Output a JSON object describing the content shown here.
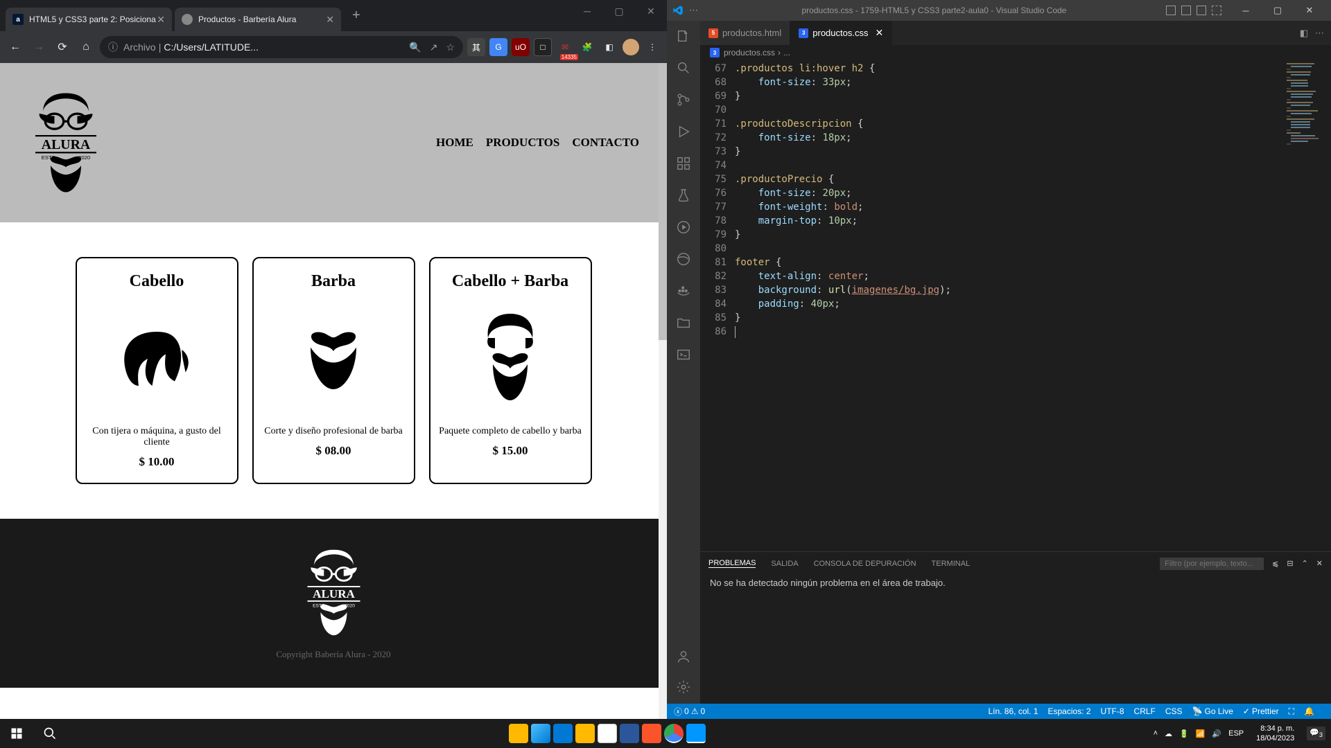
{
  "chrome": {
    "tabs": [
      {
        "title": "HTML5 y CSS3 parte 2: Posiciona",
        "favtype": "alura",
        "favlabel": "a"
      },
      {
        "title": "Productos - Barbería Alura",
        "favtype": "globe",
        "favlabel": ""
      }
    ],
    "omnibox_prefix": "Archivo",
    "omnibox_url": "C:/Users/LATITUDE...",
    "ext_badge": "14335"
  },
  "page": {
    "nav": {
      "home": "HOME",
      "productos": "PRODUCTOS",
      "contacto": "CONTACTO"
    },
    "productos": [
      {
        "title": "Cabello",
        "desc": "Con tijera o máquina, a gusto del cliente",
        "precio": "$ 10.00"
      },
      {
        "title": "Barba",
        "desc": "Corte y diseño profesional de barba",
        "precio": "$ 08.00"
      },
      {
        "title": "Cabello + Barba",
        "desc": "Paquete completo de cabello y barba",
        "precio": "$ 15.00"
      }
    ],
    "footer_copy": "Copyright Babería Alura - 2020"
  },
  "vscode": {
    "title": "productos.css - 1759-HTML5 y CSS3 parte2-aula0 - Visual Studio Code",
    "tabs": [
      {
        "name": "productos.html",
        "type": "html"
      },
      {
        "name": "productos.css",
        "type": "css",
        "active": true
      }
    ],
    "breadcrumb": "productos.css",
    "code_lines": [
      {
        "n": 67,
        "html": "<span class='selector'>.productos li:hover h2</span> <span class='punct'>{</span>"
      },
      {
        "n": 68,
        "html": "    <span class='prop'>font-size</span><span class='punct'>:</span> <span class='num'>33px</span><span class='punct'>;</span>"
      },
      {
        "n": 69,
        "html": "<span class='punct'>}</span>"
      },
      {
        "n": 70,
        "html": ""
      },
      {
        "n": 71,
        "html": "<span class='selector'>.productoDescripcion</span> <span class='punct'>{</span>"
      },
      {
        "n": 72,
        "html": "    <span class='prop'>font-size</span><span class='punct'>:</span> <span class='num'>18px</span><span class='punct'>;</span>"
      },
      {
        "n": 73,
        "html": "<span class='punct'>}</span>"
      },
      {
        "n": 74,
        "html": ""
      },
      {
        "n": 75,
        "html": "<span class='selector'>.productoPrecio</span> <span class='punct'>{</span>"
      },
      {
        "n": 76,
        "html": "    <span class='prop'>font-size</span><span class='punct'>:</span> <span class='num'>20px</span><span class='punct'>;</span>"
      },
      {
        "n": 77,
        "html": "    <span class='prop'>font-weight</span><span class='punct'>:</span> <span class='val'>bold</span><span class='punct'>;</span>"
      },
      {
        "n": 78,
        "html": "    <span class='prop'>margin-top</span><span class='punct'>:</span> <span class='num'>10px</span><span class='punct'>;</span>"
      },
      {
        "n": 79,
        "html": "<span class='punct'>}</span>"
      },
      {
        "n": 80,
        "html": ""
      },
      {
        "n": 81,
        "html": "<span class='selector'>footer</span> <span class='punct'>{</span>"
      },
      {
        "n": 82,
        "html": "    <span class='prop'>text-align</span><span class='punct'>:</span> <span class='val'>center</span><span class='punct'>;</span>"
      },
      {
        "n": 83,
        "html": "    <span class='prop'>background</span><span class='punct'>:</span> <span class='func'>url</span><span class='punct'>(</span><span class='url'>imagenes/bg.jpg</span><span class='punct'>);</span>"
      },
      {
        "n": 84,
        "html": "    <span class='prop'>padding</span><span class='punct'>:</span> <span class='num'>40px</span><span class='punct'>;</span>"
      },
      {
        "n": 85,
        "html": "<span class='punct'>}</span>"
      },
      {
        "n": 86,
        "html": "<span class='vsc-cursor'></span>"
      }
    ],
    "panel": {
      "tabs": {
        "problemas": "PROBLEMAS",
        "salida": "SALIDA",
        "consola": "CONSOLA DE DEPURACIÓN",
        "terminal": "TERMINAL"
      },
      "filter_placeholder": "Filtro (por ejemplo, texto...",
      "message": "No se ha detectado ningún problema en el área de trabajo."
    },
    "status": {
      "errors": "0",
      "warnings": "0",
      "pos": "Lín. 86, col. 1",
      "spaces": "Espacios: 2",
      "encoding": "UTF-8",
      "eol": "CRLF",
      "lang": "CSS",
      "golive": "Go Live",
      "prettier": "Prettier"
    }
  },
  "taskbar": {
    "time": "8:34 p. m.",
    "date": "18/04/2023",
    "lang": "ESP",
    "notif": "3"
  }
}
